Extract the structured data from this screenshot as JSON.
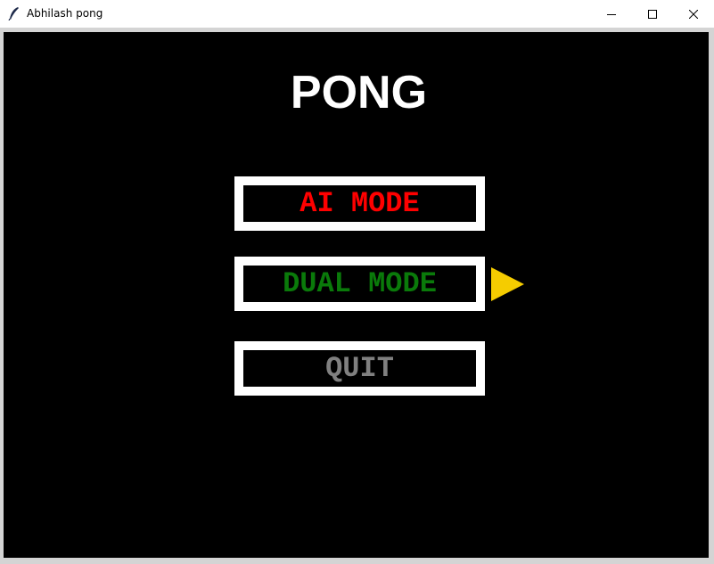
{
  "window": {
    "title": "Abhilash pong",
    "controls": {
      "minimize_icon": "minimize-icon",
      "maximize_icon": "maximize-icon",
      "close_icon": "close-icon"
    }
  },
  "game": {
    "title": "PONG",
    "background_color": "#000000",
    "menu": [
      {
        "label": "AI MODE",
        "color": "#ff0000",
        "selected": false
      },
      {
        "label": "DUAL MODE",
        "color": "#0a7a0a",
        "selected": true
      },
      {
        "label": "QUIT",
        "color": "#808080",
        "selected": false
      }
    ],
    "selector": {
      "icon": "selector-triangle-icon",
      "color": "#f5cc00"
    }
  }
}
